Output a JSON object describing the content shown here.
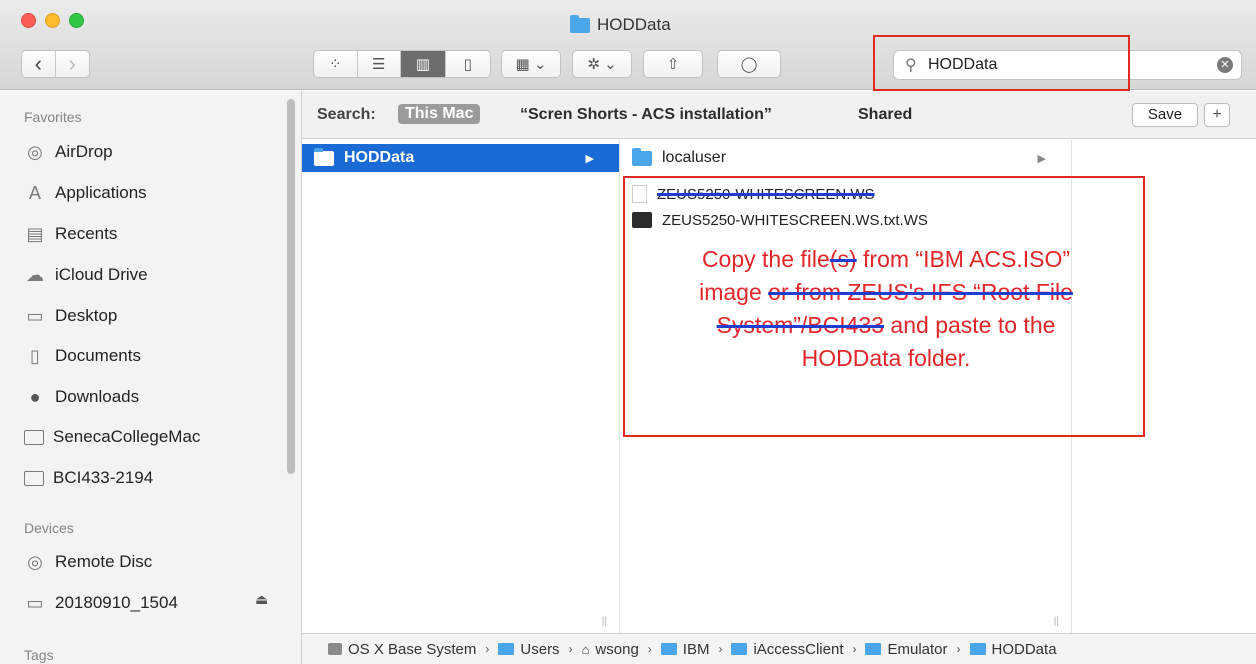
{
  "window": {
    "title": "HODData"
  },
  "toolbar": {
    "back_glyph": "‹",
    "forward_glyph": "›",
    "view_icons": "⁘",
    "view_list": "☰",
    "view_columns": "▥",
    "view_coverflow": "▯",
    "group_glyph": "▦ ⌄",
    "action_glyph": "✲ ⌄",
    "share_glyph": "⇧",
    "tag_glyph": "◯"
  },
  "search": {
    "value": "HODData",
    "clear_glyph": "✕"
  },
  "sidebar": {
    "favorites_header": "Favorites",
    "favorites": [
      {
        "label": "AirDrop",
        "icon": "airdrop-icon",
        "glyph": "◎"
      },
      {
        "label": "Applications",
        "icon": "applications-icon",
        "glyph": "A"
      },
      {
        "label": "Recents",
        "icon": "recents-icon",
        "glyph": "▤"
      },
      {
        "label": "iCloud Drive",
        "icon": "icloud-icon",
        "glyph": "☁"
      },
      {
        "label": "Desktop",
        "icon": "desktop-icon",
        "glyph": "▭"
      },
      {
        "label": "Documents",
        "icon": "documents-icon",
        "glyph": "▯"
      },
      {
        "label": "Downloads",
        "icon": "downloads-icon",
        "glyph": "●"
      },
      {
        "label": "SenecaCollegeMac",
        "icon": "folder-icon"
      },
      {
        "label": "BCI433-2194",
        "icon": "folder-icon"
      }
    ],
    "devices_header": "Devices",
    "devices": [
      {
        "label": "Remote Disc",
        "icon": "disc-icon",
        "glyph": "◎"
      },
      {
        "label": "20180910_1504",
        "icon": "drive-icon",
        "glyph": "▭"
      }
    ],
    "eject_glyph": "⏏",
    "tags_header": "Tags"
  },
  "scope_bar": {
    "label": "Search:",
    "scope_this_mac": "This Mac",
    "scope_folder": "“Scren Shorts - ACS installation”",
    "scope_shared": "Shared",
    "save_label": "Save",
    "plus_label": "+"
  },
  "column1": {
    "items": [
      {
        "label": "HODData",
        "selected": true,
        "arrow": "▶"
      }
    ]
  },
  "column2": {
    "items": [
      {
        "label": "localuser",
        "kind": "folder",
        "arrow": "▶"
      },
      {
        "label": "ZEUS5250-WHITESCREEN.WS",
        "kind": "file",
        "struck": true
      },
      {
        "label": "ZEUS5250-WHITESCREEN.WS.txt.WS",
        "kind": "terminal"
      }
    ]
  },
  "annotation": {
    "line1a": "Copy the file",
    "line1b": "(s)",
    "line1c": " from “IBM ACS.ISO”",
    "line2a": "image ",
    "line2b": "or from ZEUS's IFS “Root File",
    "line3a": "System”/BCI433",
    "line3b": " and paste to the",
    "line4": "HODData folder."
  },
  "column_handle_glyph": "||",
  "pathbar": {
    "separator": "›",
    "segments": [
      "OS X Base System",
      "Users",
      "wsong",
      "IBM",
      "iAccessClient",
      "Emulator",
      "HODData"
    ]
  },
  "colors": {
    "accent": "#1a6bd6",
    "annotation_red": "#e2262a",
    "strike_blue": "#1c3fd2",
    "folder_blue": "#4aa6e8"
  }
}
